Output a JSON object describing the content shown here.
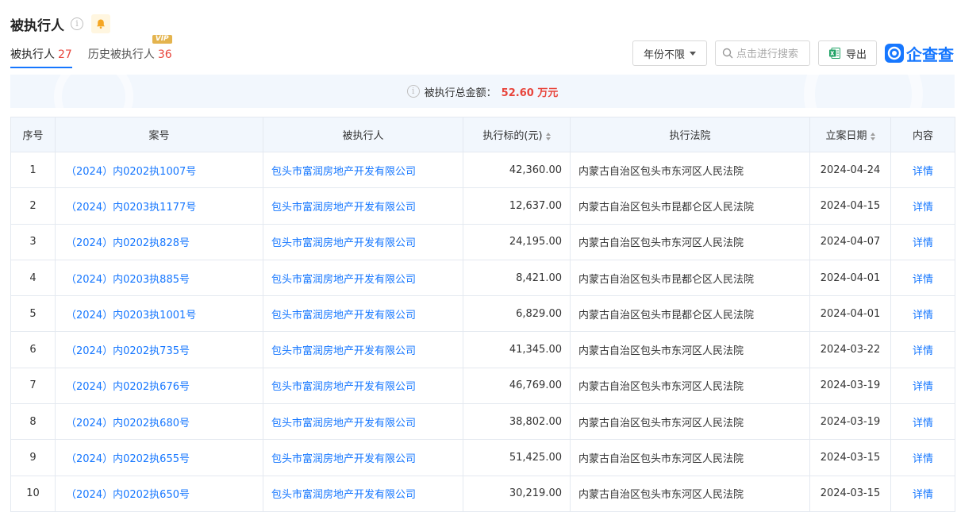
{
  "section": {
    "title": "被执行人",
    "info_glyph": "i"
  },
  "tabs": [
    {
      "label": "被执行人",
      "count": "27",
      "active": true
    },
    {
      "label": "历史被执行人",
      "count": "36",
      "badge": "VIP"
    }
  ],
  "toolbar": {
    "year_filter": "年份不限",
    "search_placeholder": "点击进行搜索",
    "export_label": "导出",
    "logo_text": "企查查"
  },
  "banner": {
    "label": "被执行总金额：",
    "amount": "52.60 万元"
  },
  "table": {
    "headers": {
      "idx": "序号",
      "case_no": "案号",
      "party": "被执行人",
      "amount": "执行标的(元)",
      "court": "执行法院",
      "date": "立案日期",
      "detail": "内容"
    },
    "rows": [
      {
        "idx": "1",
        "case_no": "（2024）内0202执1007号",
        "party": "包头市富润房地产开发有限公司",
        "amount": "42,360.00",
        "court": "内蒙古自治区包头市东河区人民法院",
        "date": "2024-04-24",
        "detail": "详情"
      },
      {
        "idx": "2",
        "case_no": "（2024）内0203执1177号",
        "party": "包头市富润房地产开发有限公司",
        "amount": "12,637.00",
        "court": "内蒙古自治区包头市昆都仑区人民法院",
        "date": "2024-04-15",
        "detail": "详情"
      },
      {
        "idx": "3",
        "case_no": "（2024）内0202执828号",
        "party": "包头市富润房地产开发有限公司",
        "amount": "24,195.00",
        "court": "内蒙古自治区包头市东河区人民法院",
        "date": "2024-04-07",
        "detail": "详情"
      },
      {
        "idx": "4",
        "case_no": "（2024）内0203执885号",
        "party": "包头市富润房地产开发有限公司",
        "amount": "8,421.00",
        "court": "内蒙古自治区包头市昆都仑区人民法院",
        "date": "2024-04-01",
        "detail": "详情"
      },
      {
        "idx": "5",
        "case_no": "（2024）内0203执1001号",
        "party": "包头市富润房地产开发有限公司",
        "amount": "6,829.00",
        "court": "内蒙古自治区包头市昆都仑区人民法院",
        "date": "2024-04-01",
        "detail": "详情"
      },
      {
        "idx": "6",
        "case_no": "（2024）内0202执735号",
        "party": "包头市富润房地产开发有限公司",
        "amount": "41,345.00",
        "court": "内蒙古自治区包头市东河区人民法院",
        "date": "2024-03-22",
        "detail": "详情"
      },
      {
        "idx": "7",
        "case_no": "（2024）内0202执676号",
        "party": "包头市富润房地产开发有限公司",
        "amount": "46,769.00",
        "court": "内蒙古自治区包头市东河区人民法院",
        "date": "2024-03-19",
        "detail": "详情"
      },
      {
        "idx": "8",
        "case_no": "（2024）内0202执680号",
        "party": "包头市富润房地产开发有限公司",
        "amount": "38,802.00",
        "court": "内蒙古自治区包头市东河区人民法院",
        "date": "2024-03-19",
        "detail": "详情"
      },
      {
        "idx": "9",
        "case_no": "（2024）内0202执655号",
        "party": "包头市富润房地产开发有限公司",
        "amount": "51,425.00",
        "court": "内蒙古自治区包头市东河区人民法院",
        "date": "2024-03-15",
        "detail": "详情"
      },
      {
        "idx": "10",
        "case_no": "（2024）内0202执650号",
        "party": "包头市富润房地产开发有限公司",
        "amount": "30,219.00",
        "court": "内蒙古自治区包头市东河区人民法院",
        "date": "2024-03-15",
        "detail": "详情"
      }
    ]
  },
  "colors": {
    "accent": "#1677ff",
    "count_red": "#e8453c",
    "header_bg": "#f2f7fd",
    "bell": "#f5a623",
    "excel_green": "#21a366",
    "vip_gold": "#e4b44e"
  },
  "icons": {
    "info": "info-circle-icon",
    "bell": "bell-icon",
    "search": "search-icon",
    "excel": "excel-icon",
    "logo": "qichacha-logo-icon",
    "sort": "sort-icon"
  }
}
